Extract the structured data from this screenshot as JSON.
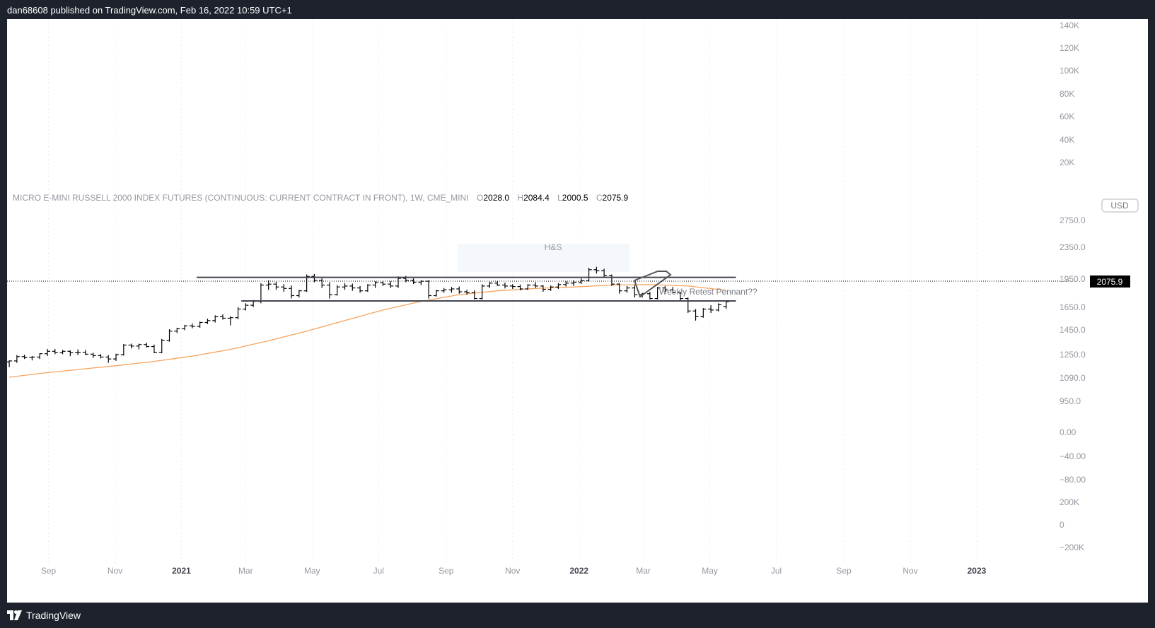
{
  "header": {
    "published": "dan68608 published on TradingView.com, Feb 16, 2022 10:59 UTC+1"
  },
  "footer": {
    "brand": "TradingView"
  },
  "colors": {
    "background": "#1e222d",
    "plot": "#ffffff",
    "bars": "#000000",
    "ma": "#f7a35c",
    "axis_text": "#9598a1",
    "last_price_bg": "#000000"
  },
  "legend": {
    "symbol": "MICRO E-MINI RUSSELL 2000 INDEX FUTURES (CONTINUOUS: CURRENT CONTRACT IN FRONT), 1W, CME_MINI",
    "o_label": "O",
    "o_value": "2028.0",
    "h_label": "H",
    "h_value": "2084.4",
    "l_label": "L",
    "l_value": "2000.5",
    "c_label": "C",
    "c_value": "2075.9"
  },
  "currency": "USD",
  "last_price": "2075.9",
  "annotations": {
    "hs_label": "H&S",
    "pennant_label": "Weekly Retest Pennant??"
  },
  "chart_data": {
    "type": "ohlc",
    "interval": "1W",
    "x_ticks": [
      {
        "label": "Sep",
        "date": "2020-09-01",
        "bold": false
      },
      {
        "label": "Nov",
        "date": "2020-11-01",
        "bold": false
      },
      {
        "label": "2021",
        "date": "2021-01-01",
        "bold": true
      },
      {
        "label": "Mar",
        "date": "2021-03-01",
        "bold": false
      },
      {
        "label": "May",
        "date": "2021-05-01",
        "bold": false
      },
      {
        "label": "Jul",
        "date": "2021-07-01",
        "bold": false
      },
      {
        "label": "Sep",
        "date": "2021-09-01",
        "bold": false
      },
      {
        "label": "Nov",
        "date": "2021-11-01",
        "bold": false
      },
      {
        "label": "2022",
        "date": "2022-01-01",
        "bold": true
      },
      {
        "label": "Mar",
        "date": "2022-03-01",
        "bold": false
      },
      {
        "label": "May",
        "date": "2022-05-01",
        "bold": false
      },
      {
        "label": "Jul",
        "date": "2022-07-01",
        "bold": false
      },
      {
        "label": "Sep",
        "date": "2022-09-01",
        "bold": false
      },
      {
        "label": "Nov",
        "date": "2022-11-01",
        "bold": false
      },
      {
        "label": "2023",
        "date": "2023-01-01",
        "bold": true
      }
    ],
    "price_ticks": [
      "2750.0",
      "2350.0",
      "1950.0",
      "1650.0",
      "1450.0",
      "1250.0",
      "1090.0",
      "950.0"
    ],
    "other_pane_ticks": [
      "140K",
      "120K",
      "100K",
      "80K",
      "60K",
      "40K",
      "20K",
      "0.00",
      "−40.00",
      "−80.00",
      "200K",
      "0",
      "−200K"
    ],
    "price_range": [
      900,
      2850
    ],
    "date_range": [
      "2020-07-25",
      "2023-03-05"
    ],
    "bars": [
      {
        "d": "2020-07-27",
        "o": 1450,
        "h": 1465,
        "l": 1395,
        "c": 1460
      },
      {
        "d": "2020-08-03",
        "o": 1460,
        "h": 1520,
        "l": 1440,
        "c": 1505
      },
      {
        "d": "2020-08-10",
        "o": 1505,
        "h": 1525,
        "l": 1480,
        "c": 1495
      },
      {
        "d": "2020-08-17",
        "o": 1495,
        "h": 1510,
        "l": 1465,
        "c": 1500
      },
      {
        "d": "2020-08-24",
        "o": 1500,
        "h": 1540,
        "l": 1480,
        "c": 1535
      },
      {
        "d": "2020-08-31",
        "o": 1535,
        "h": 1585,
        "l": 1510,
        "c": 1560
      },
      {
        "d": "2020-09-07",
        "o": 1560,
        "h": 1585,
        "l": 1530,
        "c": 1545
      },
      {
        "d": "2020-09-14",
        "o": 1545,
        "h": 1575,
        "l": 1530,
        "c": 1560
      },
      {
        "d": "2020-09-21",
        "o": 1560,
        "h": 1570,
        "l": 1510,
        "c": 1545
      },
      {
        "d": "2020-09-28",
        "o": 1545,
        "h": 1580,
        "l": 1520,
        "c": 1550
      },
      {
        "d": "2020-10-05",
        "o": 1550,
        "h": 1575,
        "l": 1520,
        "c": 1530
      },
      {
        "d": "2020-10-12",
        "o": 1530,
        "h": 1545,
        "l": 1490,
        "c": 1515
      },
      {
        "d": "2020-10-19",
        "o": 1515,
        "h": 1530,
        "l": 1485,
        "c": 1500
      },
      {
        "d": "2020-10-26",
        "o": 1500,
        "h": 1520,
        "l": 1440,
        "c": 1480
      },
      {
        "d": "2020-11-02",
        "o": 1480,
        "h": 1535,
        "l": 1460,
        "c": 1525
      },
      {
        "d": "2020-11-09",
        "o": 1525,
        "h": 1635,
        "l": 1515,
        "c": 1625
      },
      {
        "d": "2020-11-16",
        "o": 1625,
        "h": 1640,
        "l": 1590,
        "c": 1615
      },
      {
        "d": "2020-11-23",
        "o": 1615,
        "h": 1640,
        "l": 1580,
        "c": 1630
      },
      {
        "d": "2020-11-30",
        "o": 1630,
        "h": 1650,
        "l": 1600,
        "c": 1610
      },
      {
        "d": "2020-12-07",
        "o": 1610,
        "h": 1630,
        "l": 1540,
        "c": 1550
      },
      {
        "d": "2020-12-14",
        "o": 1550,
        "h": 1690,
        "l": 1540,
        "c": 1675
      },
      {
        "d": "2020-12-21",
        "o": 1675,
        "h": 1790,
        "l": 1660,
        "c": 1770
      },
      {
        "d": "2020-12-28",
        "o": 1770,
        "h": 1805,
        "l": 1750,
        "c": 1795
      },
      {
        "d": "2021-01-04",
        "o": 1795,
        "h": 1835,
        "l": 1780,
        "c": 1825
      },
      {
        "d": "2021-01-11",
        "o": 1825,
        "h": 1850,
        "l": 1800,
        "c": 1820
      },
      {
        "d": "2021-01-18",
        "o": 1820,
        "h": 1870,
        "l": 1805,
        "c": 1860
      },
      {
        "d": "2021-01-25",
        "o": 1860,
        "h": 1900,
        "l": 1845,
        "c": 1880
      },
      {
        "d": "2021-02-01",
        "o": 1880,
        "h": 1935,
        "l": 1860,
        "c": 1920
      },
      {
        "d": "2021-02-08",
        "o": 1920,
        "h": 1945,
        "l": 1890,
        "c": 1905
      },
      {
        "d": "2021-02-15",
        "o": 1905,
        "h": 1925,
        "l": 1830,
        "c": 1910
      },
      {
        "d": "2021-02-22",
        "o": 1910,
        "h": 2020,
        "l": 1895,
        "c": 2000
      },
      {
        "d": "2021-03-01",
        "o": 2000,
        "h": 2060,
        "l": 1985,
        "c": 2040
      },
      {
        "d": "2021-03-08",
        "o": 2040,
        "h": 2095,
        "l": 2020,
        "c": 2080
      },
      {
        "d": "2021-03-15",
        "o": 2080,
        "h": 2270,
        "l": 2060,
        "c": 2250
      },
      {
        "d": "2021-03-22",
        "o": 2250,
        "h": 2300,
        "l": 2200,
        "c": 2260
      },
      {
        "d": "2021-03-29",
        "o": 2260,
        "h": 2285,
        "l": 2200,
        "c": 2230
      },
      {
        "d": "2021-04-05",
        "o": 2230,
        "h": 2260,
        "l": 2180,
        "c": 2215
      },
      {
        "d": "2021-04-12",
        "o": 2215,
        "h": 2245,
        "l": 2110,
        "c": 2140
      },
      {
        "d": "2021-04-19",
        "o": 2140,
        "h": 2200,
        "l": 2120,
        "c": 2190
      },
      {
        "d": "2021-04-26",
        "o": 2190,
        "h": 2360,
        "l": 2180,
        "c": 2340
      },
      {
        "d": "2021-05-03",
        "o": 2340,
        "h": 2365,
        "l": 2280,
        "c": 2300
      },
      {
        "d": "2021-05-10",
        "o": 2300,
        "h": 2320,
        "l": 2220,
        "c": 2250
      },
      {
        "d": "2021-05-17",
        "o": 2250,
        "h": 2280,
        "l": 2110,
        "c": 2150
      },
      {
        "d": "2021-05-24",
        "o": 2150,
        "h": 2250,
        "l": 2140,
        "c": 2230
      },
      {
        "d": "2021-05-31",
        "o": 2230,
        "h": 2270,
        "l": 2200,
        "c": 2240
      },
      {
        "d": "2021-06-07",
        "o": 2240,
        "h": 2265,
        "l": 2190,
        "c": 2220
      },
      {
        "d": "2021-06-14",
        "o": 2220,
        "h": 2240,
        "l": 2170,
        "c": 2190
      },
      {
        "d": "2021-06-21",
        "o": 2190,
        "h": 2260,
        "l": 2180,
        "c": 2250
      },
      {
        "d": "2021-06-28",
        "o": 2250,
        "h": 2290,
        "l": 2220,
        "c": 2275
      },
      {
        "d": "2021-07-05",
        "o": 2275,
        "h": 2295,
        "l": 2240,
        "c": 2260
      },
      {
        "d": "2021-07-12",
        "o": 2260,
        "h": 2290,
        "l": 2220,
        "c": 2240
      },
      {
        "d": "2021-07-19",
        "o": 2240,
        "h": 2340,
        "l": 2220,
        "c": 2320
      },
      {
        "d": "2021-07-26",
        "o": 2320,
        "h": 2345,
        "l": 2280,
        "c": 2300
      },
      {
        "d": "2021-08-02",
        "o": 2300,
        "h": 2320,
        "l": 2260,
        "c": 2280
      },
      {
        "d": "2021-08-09",
        "o": 2280,
        "h": 2300,
        "l": 2250,
        "c": 2290
      },
      {
        "d": "2021-08-16",
        "o": 2290,
        "h": 2300,
        "l": 2110,
        "c": 2140
      },
      {
        "d": "2021-08-23",
        "o": 2140,
        "h": 2200,
        "l": 2130,
        "c": 2190
      },
      {
        "d": "2021-08-30",
        "o": 2190,
        "h": 2220,
        "l": 2170,
        "c": 2200
      },
      {
        "d": "2021-09-06",
        "o": 2200,
        "h": 2230,
        "l": 2170,
        "c": 2210
      },
      {
        "d": "2021-09-13",
        "o": 2210,
        "h": 2235,
        "l": 2160,
        "c": 2180
      },
      {
        "d": "2021-09-20",
        "o": 2180,
        "h": 2200,
        "l": 2150,
        "c": 2170
      },
      {
        "d": "2021-09-27",
        "o": 2170,
        "h": 2195,
        "l": 2100,
        "c": 2110
      },
      {
        "d": "2021-10-04",
        "o": 2110,
        "h": 2260,
        "l": 2100,
        "c": 2240
      },
      {
        "d": "2021-10-11",
        "o": 2240,
        "h": 2285,
        "l": 2220,
        "c": 2270
      },
      {
        "d": "2021-10-18",
        "o": 2270,
        "h": 2290,
        "l": 2240,
        "c": 2250
      },
      {
        "d": "2021-10-25",
        "o": 2250,
        "h": 2275,
        "l": 2215,
        "c": 2240
      },
      {
        "d": "2021-11-01",
        "o": 2240,
        "h": 2260,
        "l": 2210,
        "c": 2235
      },
      {
        "d": "2021-11-08",
        "o": 2235,
        "h": 2255,
        "l": 2195,
        "c": 2210
      },
      {
        "d": "2021-11-15",
        "o": 2210,
        "h": 2260,
        "l": 2200,
        "c": 2250
      },
      {
        "d": "2021-11-22",
        "o": 2250,
        "h": 2280,
        "l": 2220,
        "c": 2240
      },
      {
        "d": "2021-11-29",
        "o": 2240,
        "h": 2250,
        "l": 2180,
        "c": 2205
      },
      {
        "d": "2021-12-06",
        "o": 2205,
        "h": 2245,
        "l": 2190,
        "c": 2230
      },
      {
        "d": "2021-12-13",
        "o": 2230,
        "h": 2270,
        "l": 2210,
        "c": 2255
      },
      {
        "d": "2021-12-20",
        "o": 2255,
        "h": 2290,
        "l": 2235,
        "c": 2270
      },
      {
        "d": "2021-12-27",
        "o": 2270,
        "h": 2300,
        "l": 2240,
        "c": 2280
      },
      {
        "d": "2022-01-03",
        "o": 2280,
        "h": 2320,
        "l": 2260,
        "c": 2295
      },
      {
        "d": "2022-01-10",
        "o": 2295,
        "h": 2430,
        "l": 2285,
        "c": 2410
      },
      {
        "d": "2022-01-17",
        "o": 2410,
        "h": 2440,
        "l": 2370,
        "c": 2400
      },
      {
        "d": "2022-01-24",
        "o": 2400,
        "h": 2420,
        "l": 2330,
        "c": 2350
      },
      {
        "d": "2022-01-31",
        "o": 2350,
        "h": 2360,
        "l": 2240,
        "c": 2260
      },
      {
        "d": "2022-02-07",
        "o": 2260,
        "h": 2270,
        "l": 2160,
        "c": 2190
      },
      {
        "d": "2022-02-14",
        "o": 2190,
        "h": 2240,
        "l": 2170,
        "c": 2220
      },
      {
        "d": "2022-02-21",
        "o": 2220,
        "h": 2250,
        "l": 2120,
        "c": 2150
      },
      {
        "d": "2022-02-28",
        "o": 2150,
        "h": 2170,
        "l": 2120,
        "c": 2160
      },
      {
        "d": "2022-03-07",
        "o": 2160,
        "h": 2180,
        "l": 2100,
        "c": 2110
      },
      {
        "d": "2022-03-14",
        "o": 2110,
        "h": 2230,
        "l": 2100,
        "c": 2220
      },
      {
        "d": "2022-03-21",
        "o": 2220,
        "h": 2240,
        "l": 2180,
        "c": 2200
      },
      {
        "d": "2022-03-28",
        "o": 2200,
        "h": 2230,
        "l": 2160,
        "c": 2170
      },
      {
        "d": "2022-04-04",
        "o": 2170,
        "h": 2180,
        "l": 2090,
        "c": 2110
      },
      {
        "d": "2022-04-11",
        "o": 2110,
        "h": 2120,
        "l": 1960,
        "c": 1980
      },
      {
        "d": "2022-04-18",
        "o": 1980,
        "h": 2000,
        "l": 1880,
        "c": 1920
      },
      {
        "d": "2022-04-25",
        "o": 1920,
        "h": 2010,
        "l": 1910,
        "c": 2000
      },
      {
        "d": "2022-05-02",
        "o": 2000,
        "h": 2040,
        "l": 1960,
        "c": 1990
      },
      {
        "d": "2022-05-09",
        "o": 1990,
        "h": 2060,
        "l": 1975,
        "c": 2045
      },
      {
        "d": "2022-05-16",
        "o": 2028,
        "h": 2084.4,
        "l": 2000.5,
        "c": 2075.9
      }
    ],
    "ma": [
      {
        "d": "2020-07-27",
        "v": 1290
      },
      {
        "d": "2020-08-24",
        "v": 1330
      },
      {
        "d": "2020-09-28",
        "v": 1370
      },
      {
        "d": "2020-11-02",
        "v": 1410
      },
      {
        "d": "2020-12-07",
        "v": 1455
      },
      {
        "d": "2021-01-11",
        "v": 1510
      },
      {
        "d": "2021-02-15",
        "v": 1580
      },
      {
        "d": "2021-03-22",
        "v": 1670
      },
      {
        "d": "2021-04-26",
        "v": 1770
      },
      {
        "d": "2021-05-31",
        "v": 1880
      },
      {
        "d": "2021-07-05",
        "v": 1990
      },
      {
        "d": "2021-08-09",
        "v": 2080
      },
      {
        "d": "2021-09-13",
        "v": 2150
      },
      {
        "d": "2021-10-18",
        "v": 2190
      },
      {
        "d": "2021-11-22",
        "v": 2215
      },
      {
        "d": "2021-12-27",
        "v": 2230
      },
      {
        "d": "2022-01-31",
        "v": 2250
      },
      {
        "d": "2022-03-07",
        "v": 2255
      },
      {
        "d": "2022-04-11",
        "v": 2240
      },
      {
        "d": "2022-05-16",
        "v": 2195
      }
    ],
    "hlines": [
      {
        "from": "2021-01-15",
        "to": "2022-05-25",
        "v": 2330
      },
      {
        "from": "2021-02-25",
        "to": "2022-05-25",
        "v": 2085
      }
    ]
  }
}
